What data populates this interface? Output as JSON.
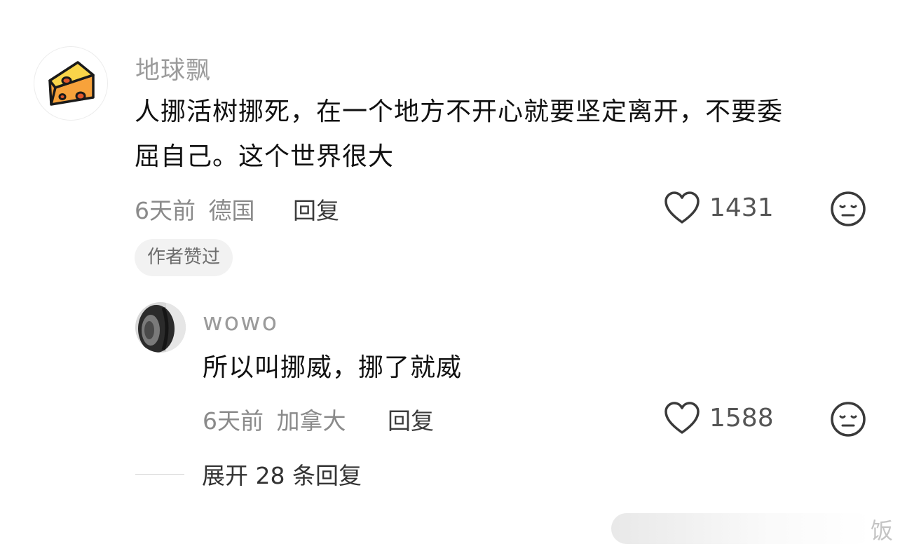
{
  "comment": {
    "username": "地球飘",
    "content_line1": "人挪活树挪死，在一个地方不开心就要坚定离开，不要委",
    "content_line2": "屈自己。这个世界很大",
    "time": "6天前",
    "location": "德国",
    "reply_label": "回复",
    "likes": "1431",
    "badge": "作者赞过",
    "avatar_icon": "cheese-icon"
  },
  "reply": {
    "username": "wowo",
    "content": "所以叫挪威，挪了就威",
    "time": "6天前",
    "location": "加拿大",
    "reply_label": "回复",
    "likes": "1588",
    "avatar_icon": "tire-photo"
  },
  "expand": {
    "label": "展开 28 条回复"
  },
  "watermark": {
    "text": "饭"
  },
  "colors": {
    "cheese": "#F7A23B",
    "cheese_holes": "#E0572B",
    "outline": "#1A1A1A",
    "muted_text": "#8A8A8A",
    "badge_bg": "#F2F2F2"
  }
}
